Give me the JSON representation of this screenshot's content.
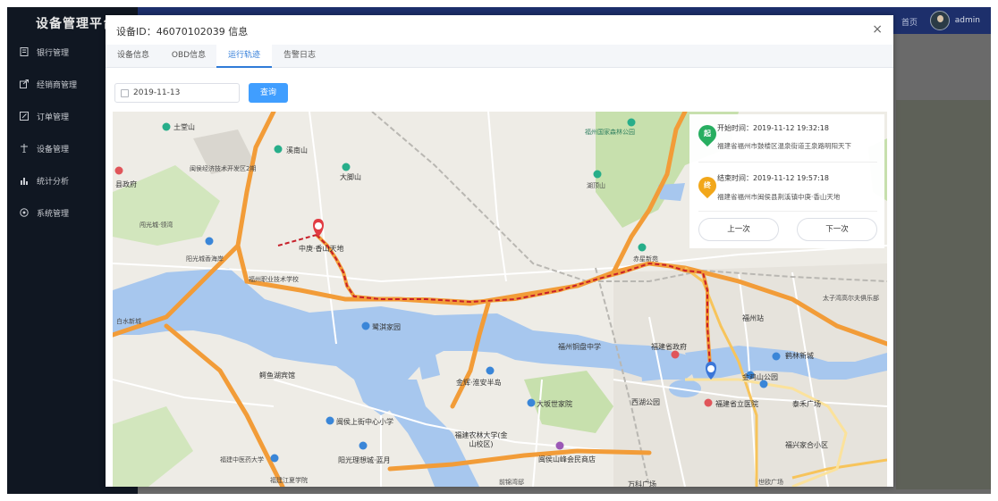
{
  "app": {
    "title": "设备管理平台"
  },
  "sidebar": {
    "items": [
      {
        "label": "银行管理",
        "icon": "document-icon"
      },
      {
        "label": "经销商管理",
        "icon": "export-icon"
      },
      {
        "label": "订单管理",
        "icon": "edit-icon"
      },
      {
        "label": "设备管理",
        "icon": "device-icon"
      },
      {
        "label": "统计分析",
        "icon": "bar-chart-icon"
      },
      {
        "label": "系统管理",
        "icon": "settings-icon"
      }
    ]
  },
  "topbar": {
    "home_label": "首页",
    "username": "admin"
  },
  "modal": {
    "title": "设备ID：46070102039 信息",
    "close": "×",
    "tabs": [
      {
        "label": "设备信息",
        "active": false
      },
      {
        "label": "OBD信息",
        "active": false
      },
      {
        "label": "运行轨迹",
        "active": true
      },
      {
        "label": "告警日志",
        "active": false
      }
    ],
    "date_value": "2019-11-13",
    "query_label": "查询"
  },
  "trip": {
    "start": {
      "badge": "起",
      "time": "开始时间：2019-11-12 19:32:18",
      "address": "福建省福州市鼓楼区温泉街道王泉路明阳天下"
    },
    "end": {
      "badge": "终",
      "time": "结束时间：2019-11-12 19:57:18",
      "address": "福建省福州市闽侯县荆溪镇中庚·香山天地"
    },
    "prev_label": "上一次",
    "next_label": "下一次"
  },
  "map": {
    "labels": [
      "土堂山",
      "溪南山",
      "大脚山",
      "闽侯经济技术开发区2期",
      "县政府",
      "闯光城·领湾",
      "阳光城香海岸",
      "福州职业技术学校",
      "中庚·香山天地",
      "福州国家森林公园",
      "湖顶山",
      "赤星新苑",
      "鹭淇家园",
      "鳄鱼湖宾馆",
      "金辉·淮安半岛",
      "福州铜盘中学",
      "福建省政府",
      "鹤林新城",
      "金鸡山公园",
      "闽侯上街中心小学",
      "阳光理想城·蓝月",
      "福建农林大学(金山校区)",
      "大坂世家院",
      "西湖公园",
      "福建省立医院",
      "泰禾广场",
      "福兴家合小区",
      "世欧广场",
      "福建中医药大学",
      "福建江夏学院",
      "福州站",
      "太子湾高尔夫俱乐部",
      "万科广场",
      "闽侯山峰会民商店",
      "白水新城",
      "前锦湾邸"
    ],
    "route_color": "#c71f2a",
    "highway_color": "#f29c38",
    "water_color": "#a7c7ee",
    "green_color": "#b7d89b"
  }
}
